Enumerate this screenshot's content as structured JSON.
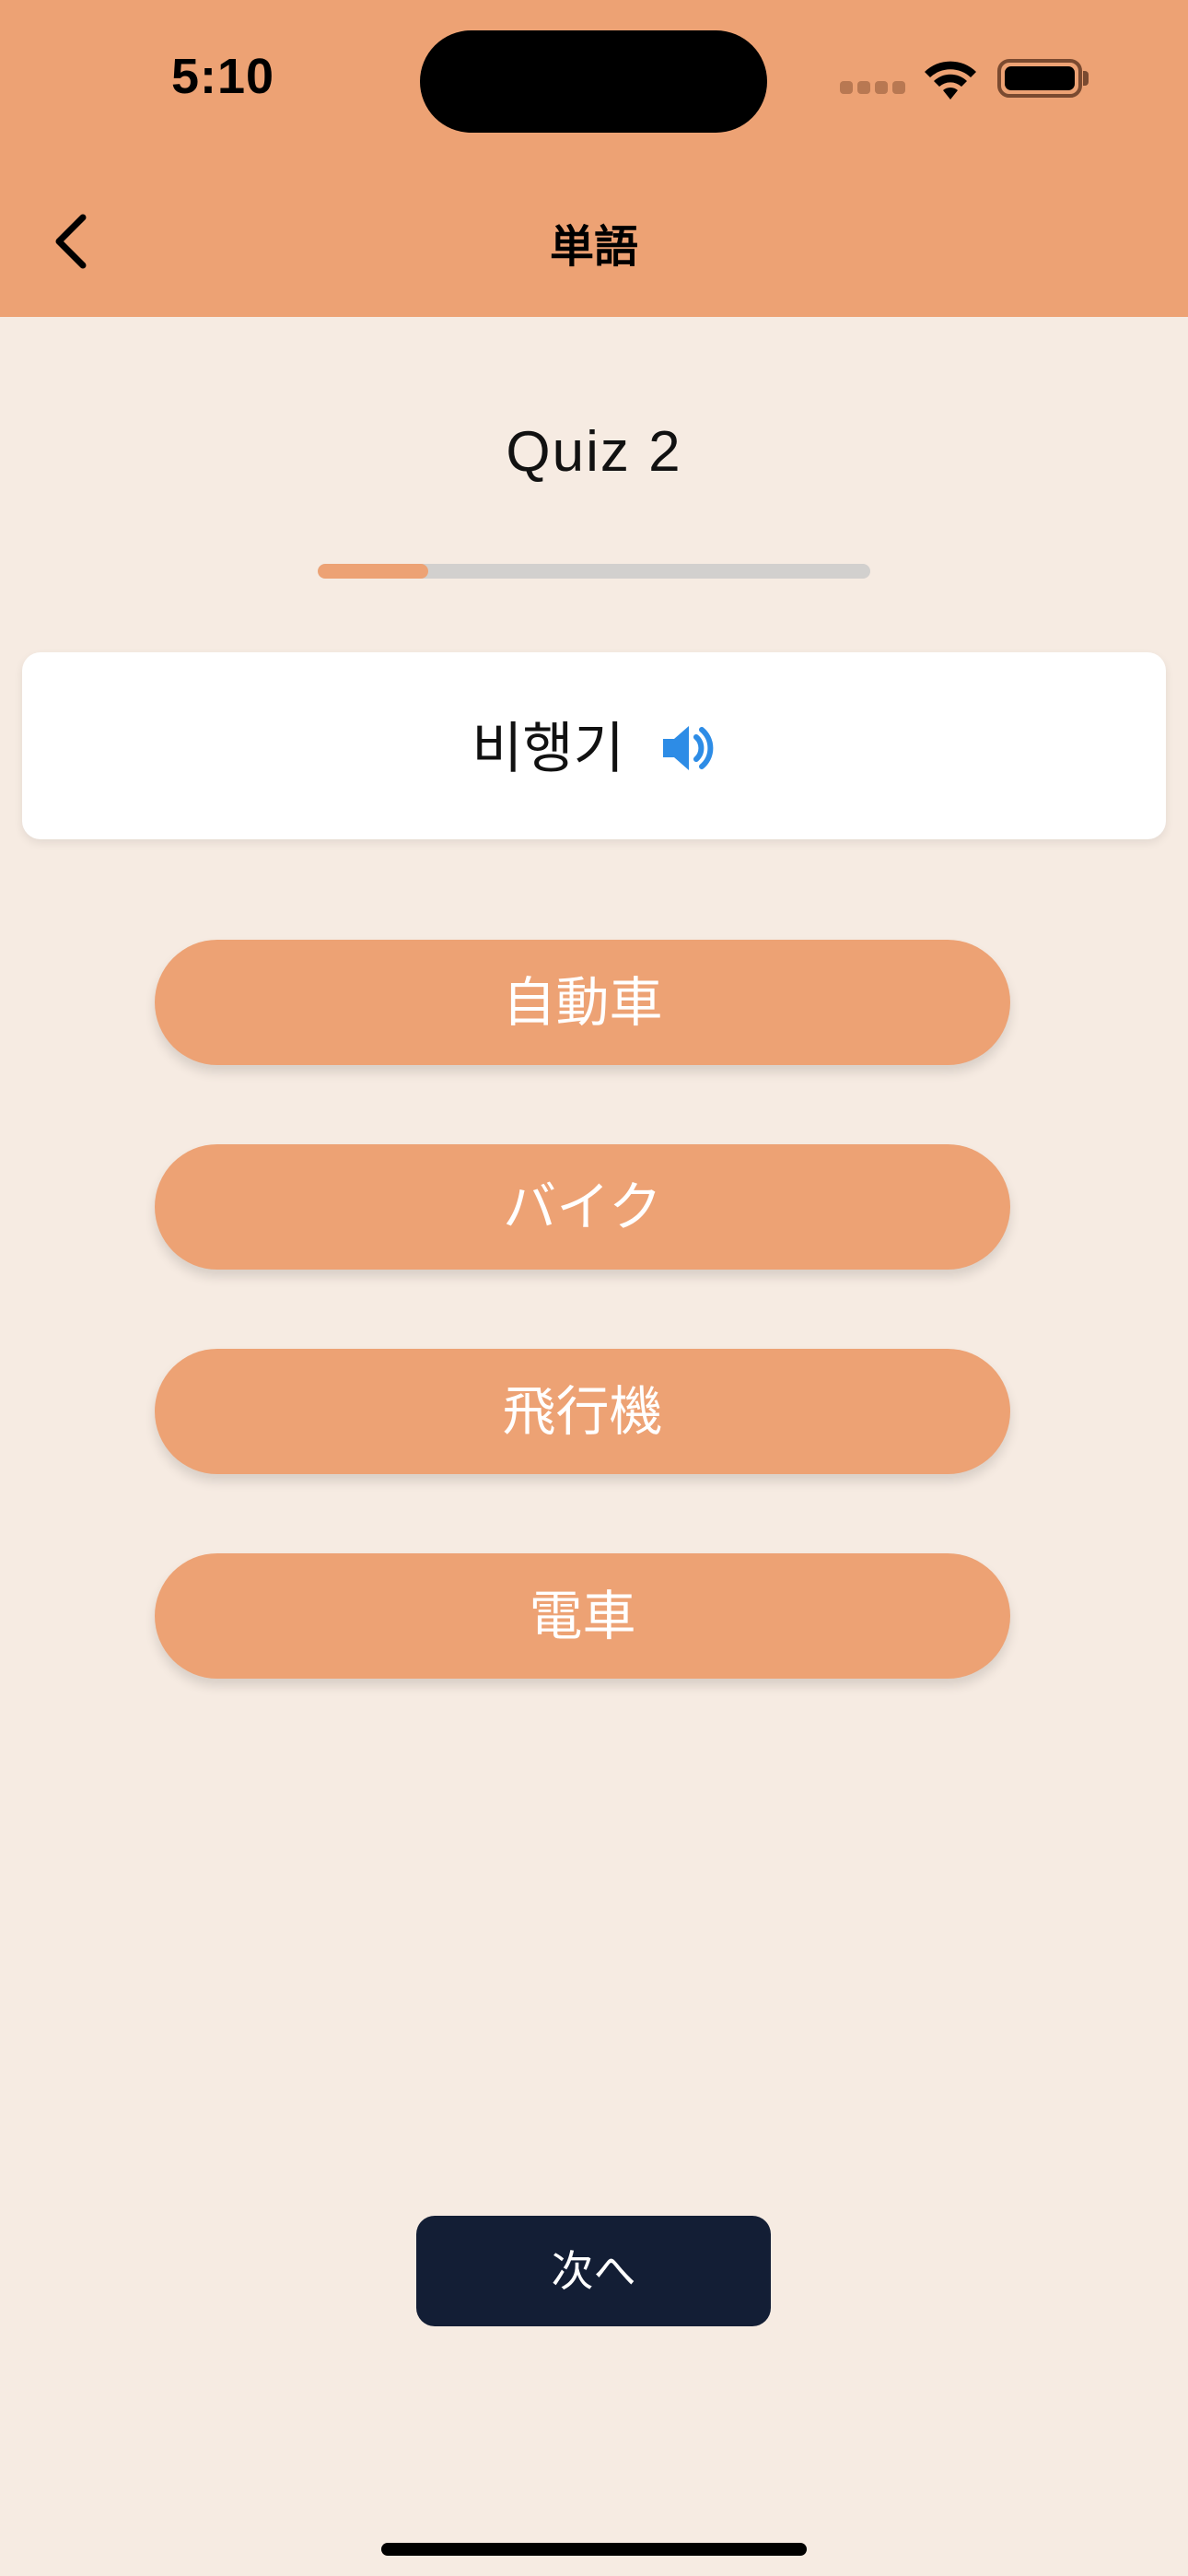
{
  "status_bar": {
    "time": "5:10"
  },
  "nav": {
    "title": "単語",
    "back_icon": "chevron-left-icon"
  },
  "quiz": {
    "title": "Quiz 2",
    "progress": 0.2,
    "word": "비행기",
    "speaker_icon": "speaker-icon"
  },
  "options": [
    {
      "label": "自動車"
    },
    {
      "label": "バイク"
    },
    {
      "label": "飛行機"
    },
    {
      "label": "電車"
    }
  ],
  "next_button": {
    "label": "次へ"
  },
  "colors": {
    "accent": "#eda274",
    "background": "#f6ebe2",
    "next_button": "#131e35",
    "speaker": "#2d8ce6"
  }
}
